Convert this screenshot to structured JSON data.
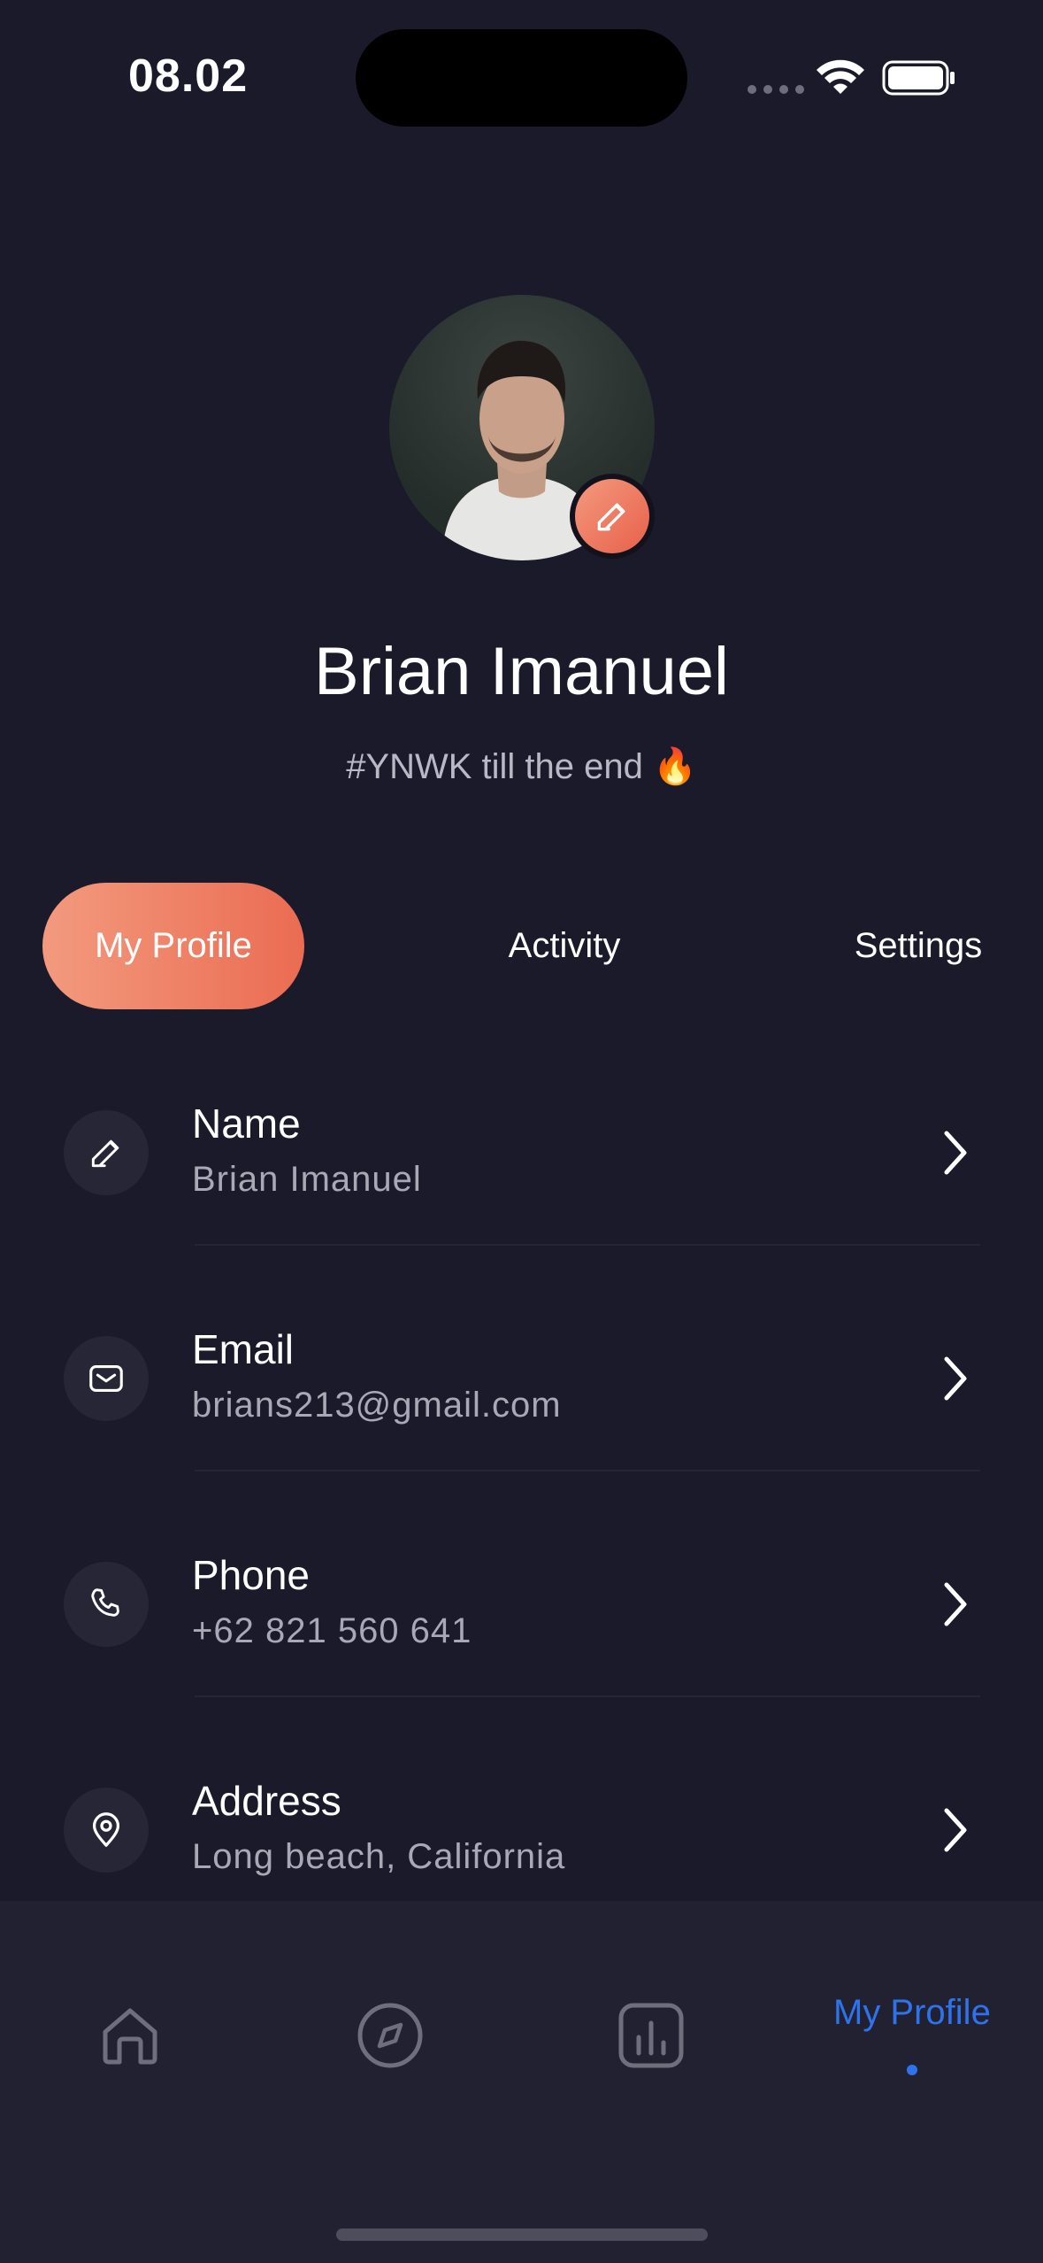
{
  "status_bar": {
    "time": "08.02"
  },
  "profile": {
    "name": "Brian Imanuel",
    "tagline": "#YNWK till the end 🔥"
  },
  "tabs": [
    {
      "label": "My Profile",
      "active": true
    },
    {
      "label": "Activity",
      "active": false
    },
    {
      "label": "Settings",
      "active": false
    }
  ],
  "details": [
    {
      "label": "Name",
      "value": "Brian Imanuel",
      "icon": "pencil-icon"
    },
    {
      "label": "Email",
      "value": "brians213@gmail.com",
      "icon": "mail-icon"
    },
    {
      "label": "Phone",
      "value": "+62 821 560 641",
      "icon": "phone-icon"
    },
    {
      "label": "Address",
      "value": "Long beach, California",
      "icon": "location-pin-icon"
    }
  ],
  "bottom_nav": {
    "items": [
      {
        "icon": "home-icon"
      },
      {
        "icon": "compass-icon"
      },
      {
        "icon": "chart-icon"
      },
      {
        "label": "My Profile",
        "active": true
      }
    ]
  },
  "colors": {
    "background": "#1b1a2b",
    "accent_gradient_start": "#f39a7e",
    "accent_gradient_end": "#ea6c52",
    "nav_active": "#2f73ec"
  }
}
